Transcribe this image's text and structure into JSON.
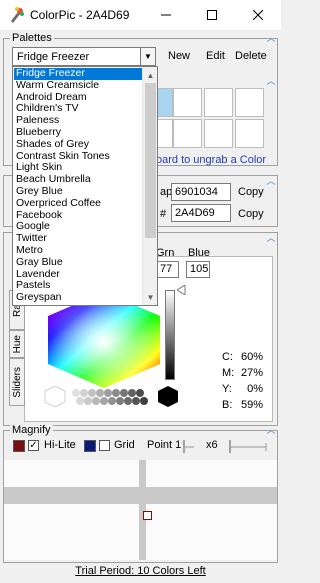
{
  "window": {
    "title": "ColorPic - 2A4D69",
    "minimize_icon": "minimize-icon",
    "maximize_icon": "maximize-icon",
    "close_icon": "close-icon"
  },
  "palettes": {
    "section_title": "Palettes",
    "selected": "Fridge Freezer",
    "new_label": "New",
    "edit_label": "Edit",
    "delete_label": "Delete",
    "options": [
      "Fridge Freezer",
      "Warm Creamsicle",
      "Android Dream",
      "Children's TV",
      "Paleness",
      "Blueberry",
      "Shades of Grey",
      "Contrast Skin Tones",
      "Light Skin",
      "Beach Umbrella",
      "Grey Blue",
      "Overpriced Coffee",
      "Facebook",
      "Google",
      "Twitter",
      "Metro",
      "Gray Blue",
      "Lavender",
      "Pastels",
      "Greyspan"
    ],
    "hint_text": "oard to ungrab a Color",
    "swatch_colors": [
      "#a9d3ee",
      "#ffffff",
      "#ffffff",
      "#ffffff",
      "#ffffff",
      "#ffffff",
      "#ffffff",
      "#ffffff"
    ]
  },
  "color_values": {
    "row1_label": "ap",
    "row1_value": "6901034",
    "row2_label": "#",
    "row2_value": "2A4D69",
    "copy_label": "Copy",
    "current_color": "#2A4D69"
  },
  "picker": {
    "green_label": "Grn",
    "blue_label": "Blue",
    "green_value": "77",
    "blue_value": "105",
    "tabs": [
      "Rai",
      "Hue",
      "Sliders"
    ],
    "cmyk": [
      {
        "label": "C:",
        "value": "60%"
      },
      {
        "label": "M:",
        "value": "27%"
      },
      {
        "label": "Y:",
        "value": "0%"
      },
      {
        "label": "B:",
        "value": "59%"
      }
    ]
  },
  "magnify": {
    "section_title": "Magnify",
    "hilite_label": "Hi-Lite",
    "grid_label": "Grid",
    "point_label": "Point 1",
    "zoom_label": "x6",
    "hilite_color": "#7a0f0f",
    "grid_color": "#0a1a7a",
    "hilite_checked": true,
    "grid_checked": false
  },
  "status": {
    "trial_text": "Trial Period: 10 Colors Left"
  }
}
